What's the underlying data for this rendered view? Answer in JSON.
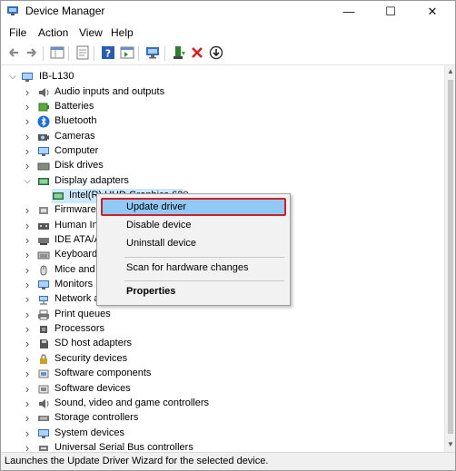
{
  "window": {
    "title": "Device Manager",
    "controls": {
      "minimize": "—",
      "maximize": "☐",
      "close": "✕"
    }
  },
  "menubar": {
    "items": [
      "File",
      "Action",
      "View",
      "Help"
    ]
  },
  "toolbar": {
    "icons": [
      "back-arrow-icon",
      "forward-arrow-icon",
      "properties-grid-icon",
      "show-hidden-icon",
      "help-icon",
      "console-icon",
      "scan-hardware-icon",
      "update-driver-icon",
      "uninstall-icon",
      "disable-icon"
    ]
  },
  "tree": {
    "root": "IB-L130",
    "categories": [
      {
        "label": "Audio inputs and outputs",
        "icon": "speaker-icon",
        "expanded": false
      },
      {
        "label": "Batteries",
        "icon": "battery-icon",
        "expanded": false
      },
      {
        "label": "Bluetooth",
        "icon": "bluetooth-icon",
        "expanded": false
      },
      {
        "label": "Cameras",
        "icon": "camera-icon",
        "expanded": false
      },
      {
        "label": "Computer",
        "icon": "computer-icon",
        "expanded": false
      },
      {
        "label": "Disk drives",
        "icon": "disk-drive-icon",
        "expanded": false
      },
      {
        "label": "Display adapters",
        "icon": "display-adapter-icon",
        "expanded": true
      },
      {
        "label": "Intel(R) UHD Graphics 620",
        "icon": "display-adapter-icon",
        "child": true,
        "selected": true
      },
      {
        "label": "Firmware",
        "icon": "firmware-icon",
        "expanded": false
      },
      {
        "label": "Human Interface Devices",
        "icon": "hid-icon",
        "expanded": false
      },
      {
        "label": "IDE ATA/ATAPI controllers",
        "icon": "ide-controller-icon",
        "expanded": false
      },
      {
        "label": "Keyboards",
        "icon": "keyboard-icon",
        "expanded": false
      },
      {
        "label": "Mice and other pointing devices",
        "icon": "mouse-icon",
        "expanded": false
      },
      {
        "label": "Monitors",
        "icon": "monitor-icon",
        "expanded": false
      },
      {
        "label": "Network adapters",
        "icon": "network-adapter-icon",
        "expanded": false
      },
      {
        "label": "Print queues",
        "icon": "printer-icon",
        "expanded": false
      },
      {
        "label": "Processors",
        "icon": "processor-icon",
        "expanded": false
      },
      {
        "label": "SD host adapters",
        "icon": "sd-card-icon",
        "expanded": false
      },
      {
        "label": "Security devices",
        "icon": "security-key-icon",
        "expanded": false
      },
      {
        "label": "Software components",
        "icon": "software-component-icon",
        "expanded": false
      },
      {
        "label": "Software devices",
        "icon": "software-device-icon",
        "expanded": false
      },
      {
        "label": "Sound, video and game controllers",
        "icon": "sound-icon",
        "expanded": false
      },
      {
        "label": "Storage controllers",
        "icon": "storage-controller-icon",
        "expanded": false
      },
      {
        "label": "System devices",
        "icon": "system-device-icon",
        "expanded": false
      },
      {
        "label": "Universal Serial Bus controllers",
        "icon": "usb-icon",
        "expanded": false
      }
    ]
  },
  "context_menu": {
    "items": [
      {
        "label": "Update driver",
        "highlighted": true
      },
      {
        "label": "Disable device"
      },
      {
        "label": "Uninstall device"
      },
      {
        "label": "Scan for hardware changes"
      },
      {
        "label": "Properties",
        "bold": true
      }
    ]
  },
  "statusbar": {
    "text": "Launches the Update Driver Wizard for the selected device."
  },
  "colors": {
    "selection": "#cce8ff",
    "menu_highlight": "#91c9f7",
    "callout_border": "#d0202a"
  }
}
